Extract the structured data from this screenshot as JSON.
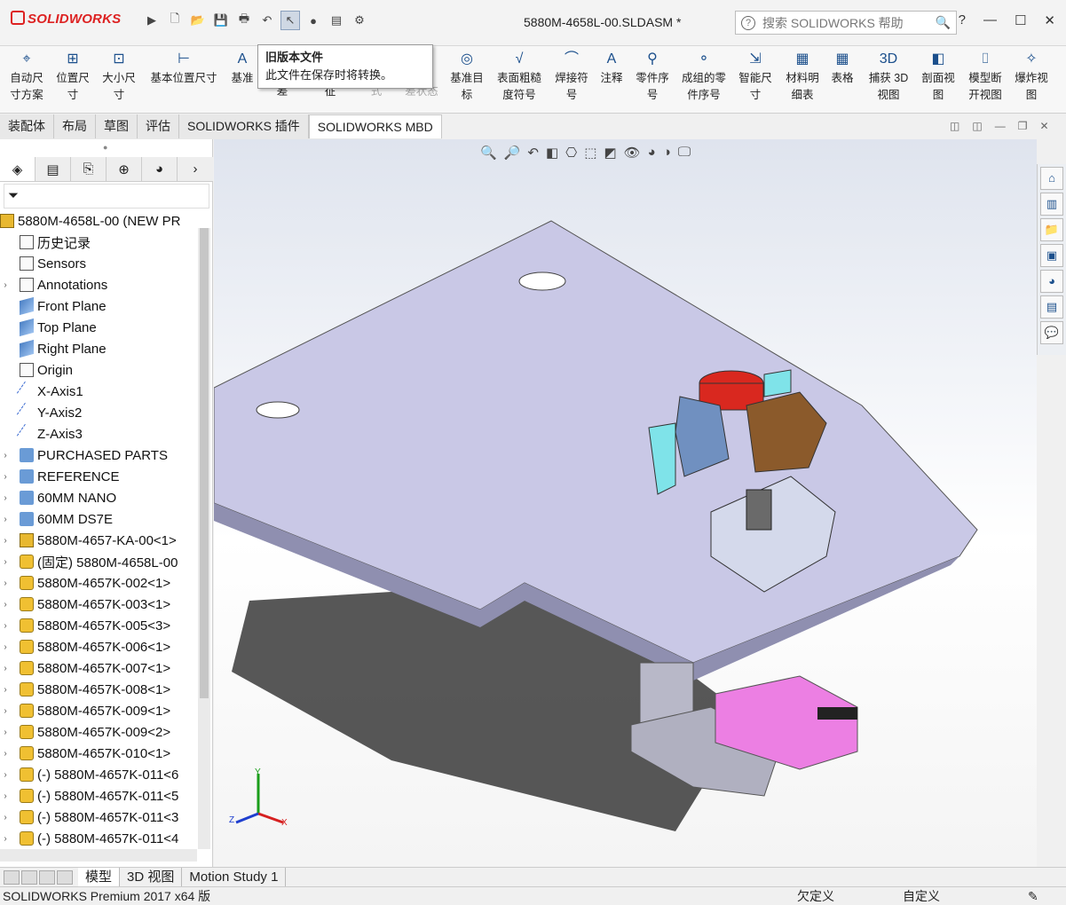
{
  "app": {
    "brand": "SOLIDWORKS",
    "document_title": "5880M-4658L-00.SLDASM *"
  },
  "search": {
    "placeholder": "搜索 SOLIDWORKS 帮助"
  },
  "window_buttons": {
    "help": "?",
    "minimize": "—",
    "restore": "☐",
    "close": "✕"
  },
  "tooltip": {
    "title": "旧版本文件",
    "body": "此文件在保存时将转换。"
  },
  "ribbon": {
    "auto_dim": "自动尺\n寸方案",
    "location_dim": "位置尺\n寸",
    "size_dim": "大小尺\n寸",
    "basic_location": "基本位置尺寸",
    "datum": "基准",
    "diff": "差",
    "feature": "征",
    "style": "式",
    "diff_state": "差状态",
    "datum_target": "基准目\n标",
    "surface_finish": "表面粗糙\n度符号",
    "weld": "焊接符\n号",
    "note": "注释",
    "balloon": "零件序\n号",
    "stacked_balloon": "成组的零\n件序号",
    "smart_dim": "智能尺\n寸",
    "bom": "材料明\n细表",
    "table": "表格",
    "capture3d": "捕获 3D\n视图",
    "section": "剖面视\n图",
    "model_break": "模型断\n开视图",
    "explode": "爆炸视\n图"
  },
  "tabs": [
    "装配体",
    "布局",
    "草图",
    "评估",
    "SOLIDWORKS 插件",
    "SOLIDWORKS MBD"
  ],
  "active_tab": "SOLIDWORKS MBD",
  "feature_tree": [
    {
      "label": "5880M-4658L-00  (NEW PR",
      "icon": "asm",
      "root": true,
      "exp": ""
    },
    {
      "label": "历史记录",
      "icon": "doc",
      "exp": ""
    },
    {
      "label": "Sensors",
      "icon": "doc",
      "exp": ""
    },
    {
      "label": "Annotations",
      "icon": "doc",
      "exp": "›"
    },
    {
      "label": "Front Plane",
      "icon": "pl",
      "exp": ""
    },
    {
      "label": "Top Plane",
      "icon": "pl",
      "exp": ""
    },
    {
      "label": "Right Plane",
      "icon": "pl",
      "exp": ""
    },
    {
      "label": "Origin",
      "icon": "doc",
      "exp": ""
    },
    {
      "label": "X-Axis1",
      "icon": "ax",
      "exp": ""
    },
    {
      "label": "Y-Axis2",
      "icon": "ax",
      "exp": ""
    },
    {
      "label": "Z-Axis3",
      "icon": "ax",
      "exp": ""
    },
    {
      "label": "PURCHASED PARTS",
      "icon": "fld",
      "exp": "›"
    },
    {
      "label": "REFERENCE",
      "icon": "fld",
      "exp": "›"
    },
    {
      "label": "60MM NANO",
      "icon": "fld",
      "exp": "›"
    },
    {
      "label": "60MM DS7E",
      "icon": "fld",
      "exp": "›"
    },
    {
      "label": "5880M-4657-KA-00<1>",
      "icon": "asm",
      "exp": "›"
    },
    {
      "label": "(固定) 5880M-4658L-00",
      "icon": "prt",
      "exp": "›"
    },
    {
      "label": "5880M-4657K-002<1>",
      "icon": "prt",
      "exp": "›"
    },
    {
      "label": "5880M-4657K-003<1>",
      "icon": "prt",
      "exp": "›"
    },
    {
      "label": "5880M-4657K-005<3>",
      "icon": "prt",
      "exp": "›"
    },
    {
      "label": "5880M-4657K-006<1>",
      "icon": "prt",
      "exp": "›"
    },
    {
      "label": "5880M-4657K-007<1>",
      "icon": "prt",
      "exp": "›"
    },
    {
      "label": "5880M-4657K-008<1>",
      "icon": "prt",
      "exp": "›"
    },
    {
      "label": "5880M-4657K-009<1>",
      "icon": "prt",
      "exp": "›"
    },
    {
      "label": "5880M-4657K-009<2>",
      "icon": "prt",
      "exp": "›"
    },
    {
      "label": "5880M-4657K-010<1>",
      "icon": "prt",
      "exp": "›"
    },
    {
      "label": "(-) 5880M-4657K-011<6",
      "icon": "prt",
      "exp": "›"
    },
    {
      "label": "(-) 5880M-4657K-011<5",
      "icon": "prt",
      "exp": "›"
    },
    {
      "label": "(-) 5880M-4657K-011<3",
      "icon": "prt",
      "exp": "›"
    },
    {
      "label": "(-) 5880M-4657K-011<4",
      "icon": "prt",
      "exp": "›"
    }
  ],
  "bottom_tabs": [
    "模型",
    "3D 视图",
    "Motion Study 1"
  ],
  "status": {
    "left": "SOLIDWORKS Premium 2017 x64 版",
    "mid": "欠定义",
    "right": "自定义"
  },
  "triad": {
    "x": "X",
    "y": "Y",
    "z": "Z"
  },
  "colors": {
    "plate": "#c9c8e6",
    "pink": "#ec7fe3",
    "red": "#d9281f",
    "cyan": "#7fe3e9",
    "brown": "#8b5a2b"
  }
}
